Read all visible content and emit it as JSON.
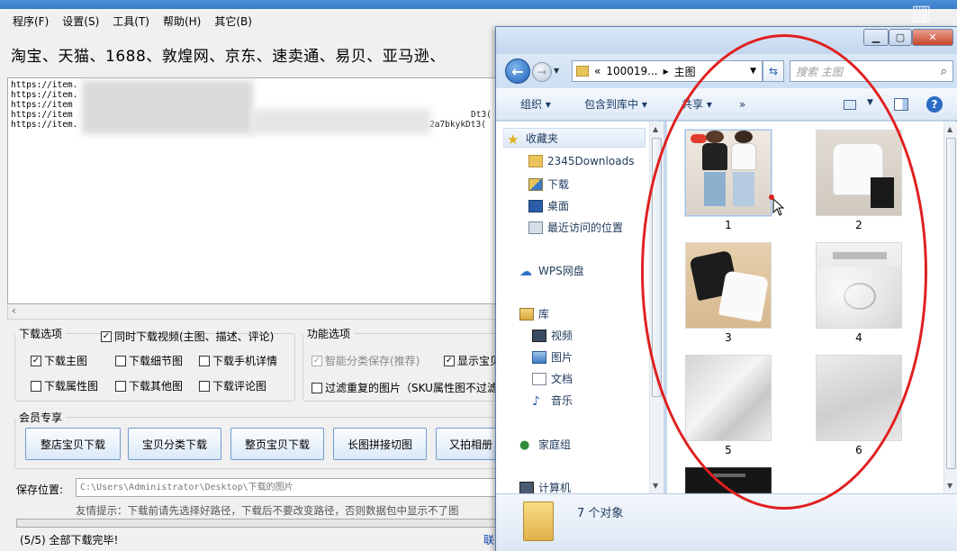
{
  "app": {
    "menu": [
      "程序(F)",
      "设置(S)",
      "工具(T)",
      "帮助(H)",
      "其它(B)"
    ],
    "platforms": "淘宝、天猫、1688、敦煌网、京东、速卖通、易贝、亚马逊、",
    "urls": [
      {
        "prefix": "https://item.",
        "tail": ""
      },
      {
        "prefix": "https://item.",
        "tail": ""
      },
      {
        "prefix": "https://item",
        "tail": ""
      },
      {
        "prefix": "https://item",
        "tail": "Dt3("
      },
      {
        "prefix": "https://item.",
        "tail": "2a7bkykDt3("
      }
    ],
    "download_options": {
      "legend": "下载选项",
      "video": "同时下载视频(主图、描述、评论)",
      "main_image": "下载主图",
      "detail_image": "下载细节图",
      "mobile_detail": "下载手机详情",
      "attr_image": "下载属性图",
      "other_image": "下载其他图",
      "review_image": "下载评论图"
    },
    "function_options": {
      "legend": "功能选项",
      "smart_save": "智能分类保存(推荐)",
      "show_item": "显示宝贝",
      "filter_dup": "过滤重复的图片（SKU属性图不过滤"
    },
    "member": {
      "legend": "会员专享",
      "buttons": [
        "整店宝贝下载",
        "宝贝分类下载",
        "整页宝贝下载",
        "长图拼接切图",
        "又拍相册"
      ]
    },
    "save_label": "保存位置:",
    "save_path": "C:\\Users\\Administrator\\Desktop\\下载的图片",
    "tip": "友情提示：下载前请先选择好路径，下载后不要改变路径，否则数据包中显示不了图",
    "status": "(5/5) 全部下载完毕!",
    "contact": "联"
  },
  "explorer": {
    "breadcrumb": {
      "prefix": "«",
      "folder": "100019...",
      "sep": "▸",
      "current": "主图"
    },
    "search_placeholder": "搜索 主图",
    "toolbar": {
      "organize": "组织 ▾",
      "include": "包含到库中 ▾",
      "share": "共享 ▾",
      "more": "»"
    },
    "nav": {
      "favorites": "收藏夹",
      "downloads2345": "2345Downloads",
      "downloads": "下载",
      "desktop": "桌面",
      "recent": "最近访问的位置",
      "wps": "WPS网盘",
      "library": "库",
      "video": "视频",
      "pictures": "图片",
      "documents": "文档",
      "music": "音乐",
      "homegroup": "家庭组",
      "computer": "计算机"
    },
    "files": [
      "1",
      "2",
      "3",
      "4",
      "5",
      "6"
    ],
    "status": "7 个对象"
  },
  "colors": {
    "accent": "#3b7bc8",
    "annotation": "#e02020"
  }
}
